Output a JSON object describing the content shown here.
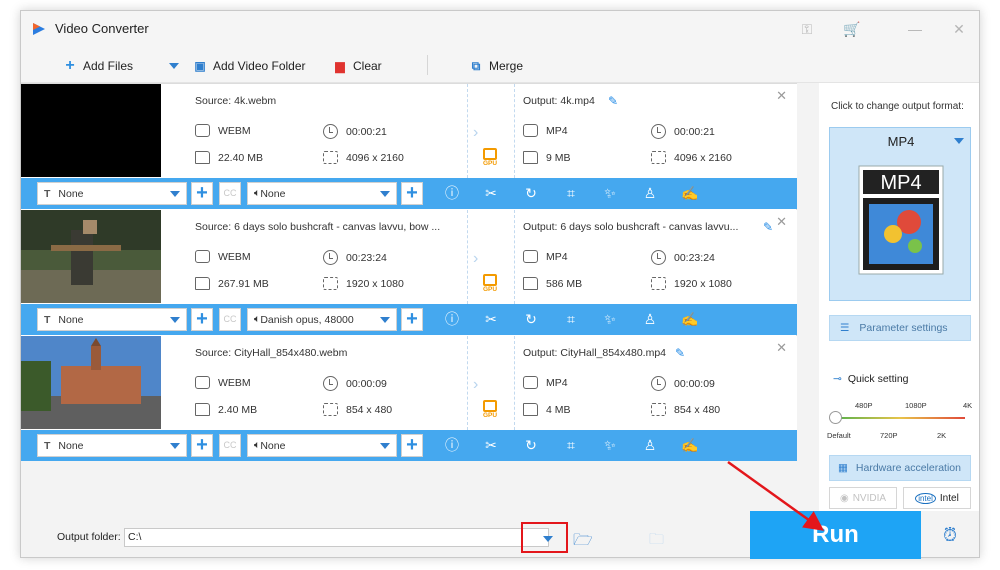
{
  "app": {
    "title": "Video Converter"
  },
  "toolbar": {
    "add_files": "Add Files",
    "add_folder": "Add Video Folder",
    "clear": "Clear",
    "merge": "Merge"
  },
  "items": [
    {
      "source": "Source: 4k.webm",
      "output": "Output: 4k.mp4",
      "src_format": "WEBM",
      "src_duration": "00:00:21",
      "src_size": "22.40 MB",
      "src_res": "4096 x 2160",
      "out_format": "MP4",
      "out_duration": "00:00:21",
      "out_size": "9 MB",
      "out_res": "4096 x 2160",
      "subtitle": "None",
      "audio": "None"
    },
    {
      "source": "Source: 6 days solo bushcraft - canvas lavvu, bow ...",
      "output": "Output: 6 days solo bushcraft - canvas lavvu...",
      "src_format": "WEBM",
      "src_duration": "00:23:24",
      "src_size": "267.91 MB",
      "src_res": "1920 x 1080",
      "out_format": "MP4",
      "out_duration": "00:23:24",
      "out_size": "586 MB",
      "out_res": "1920 x 1080",
      "subtitle": "None",
      "audio": "Danish opus, 48000"
    },
    {
      "source": "Source: CityHall_854x480.webm",
      "output": "Output: CityHall_854x480.mp4",
      "src_format": "WEBM",
      "src_duration": "00:00:09",
      "src_size": "2.40 MB",
      "src_res": "854 x 480",
      "out_format": "MP4",
      "out_duration": "00:00:09",
      "out_size": "4 MB",
      "out_res": "854 x 480",
      "subtitle": "None",
      "audio": "None"
    }
  ],
  "gpu_label": "GPU",
  "cc_label": "CC",
  "panel": {
    "title": "Click to change output format:",
    "format": "MP4",
    "format_image_text": "MP4",
    "param_settings": "Parameter settings",
    "quick_setting": "Quick setting",
    "quality_top": [
      "480P",
      "1080P",
      "4K"
    ],
    "quality_bottom": [
      "Default",
      "720P",
      "2K"
    ],
    "hw_accel": "Hardware acceleration",
    "nvidia": "NVIDIA",
    "intel": "Intel"
  },
  "bottom": {
    "output_folder_label": "Output folder:",
    "output_folder_value": "C:\\",
    "run": "Run"
  },
  "colors": {
    "accent": "#1ea4f5",
    "bar": "#45a8ef",
    "gpu": "#f39a00",
    "highlight": "#e3161b"
  }
}
